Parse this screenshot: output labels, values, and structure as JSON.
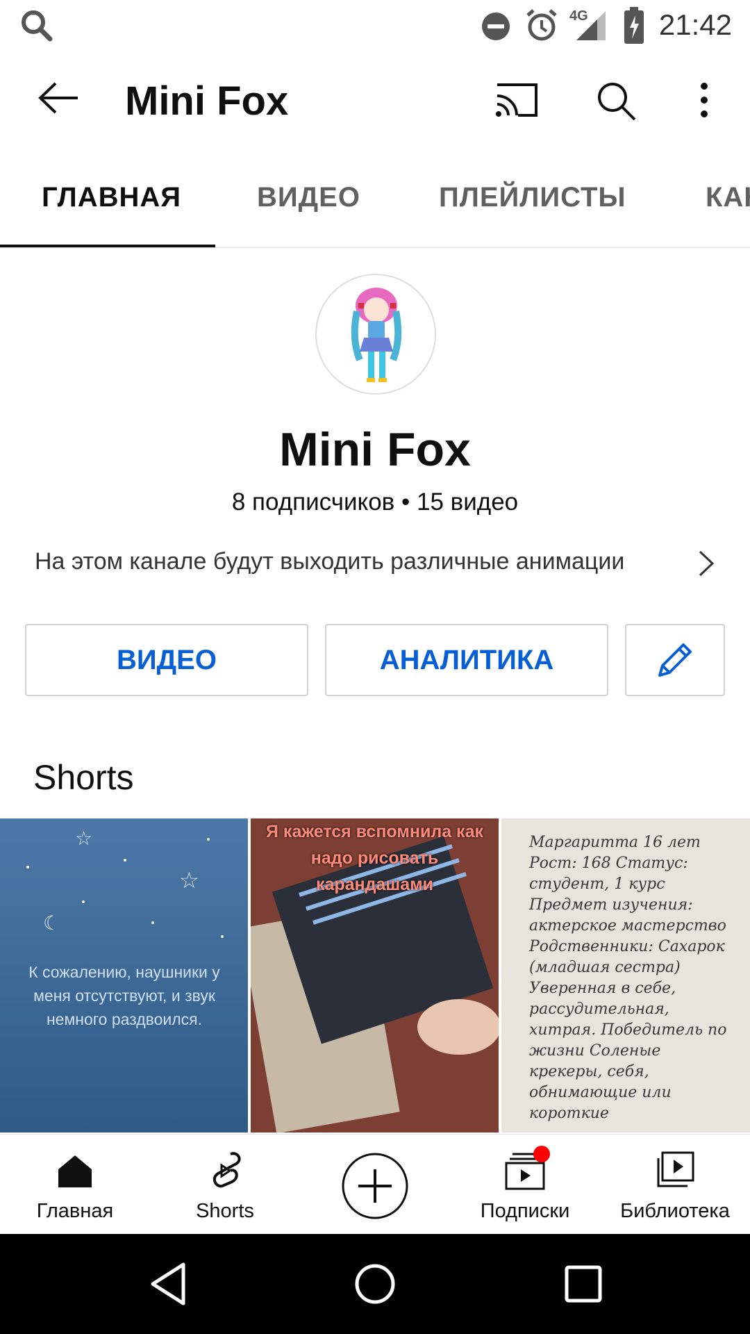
{
  "status_bar": {
    "time": "21:42",
    "network": "4G"
  },
  "app_bar": {
    "title": "Mini Fox"
  },
  "tabs": [
    {
      "label": "ГЛАВНАЯ",
      "active": true
    },
    {
      "label": "ВИДЕО",
      "active": false
    },
    {
      "label": "ПЛЕЙЛИСТЫ",
      "active": false
    },
    {
      "label": "КАНАЛЫ",
      "active": false
    }
  ],
  "channel": {
    "name": "Mini Fox",
    "stats": "8 подписчиков • 15 видео",
    "description": "На этом канале будут выходить различные анимации"
  },
  "actions": {
    "video_label": "ВИДЕО",
    "analytics_label": "АНАЛИТИКА"
  },
  "shorts": {
    "heading": "Shorts",
    "items": [
      {
        "caption": "К сожалению, наушники у меня отсутствуют, и звук немного раздвоился."
      },
      {
        "caption": "Я кажется вспомнила как надо рисовать карандашами"
      },
      {
        "caption": "Маргаритта 16 лет Рост: 168 Статус: студент, 1 курс Предмет изучения: актерское мастерство Родственники: Сахарок (младшая сестра) Уверенная в себе, рассудительная, хитрая. Победитель по жизни Соленые крекеры, себя, обнимающие или короткие"
      }
    ]
  },
  "bottom_nav": [
    {
      "label": "Главная",
      "icon": "home-icon"
    },
    {
      "label": "Shorts",
      "icon": "shorts-icon"
    },
    {
      "label": "",
      "icon": "create-plus-icon"
    },
    {
      "label": "Подписки",
      "icon": "subscriptions-icon",
      "badge": true
    },
    {
      "label": "Библиотека",
      "icon": "library-icon"
    }
  ],
  "colors": {
    "accent": "#065fd4",
    "badge": "#ff0000",
    "text": "#0f0f0f"
  }
}
